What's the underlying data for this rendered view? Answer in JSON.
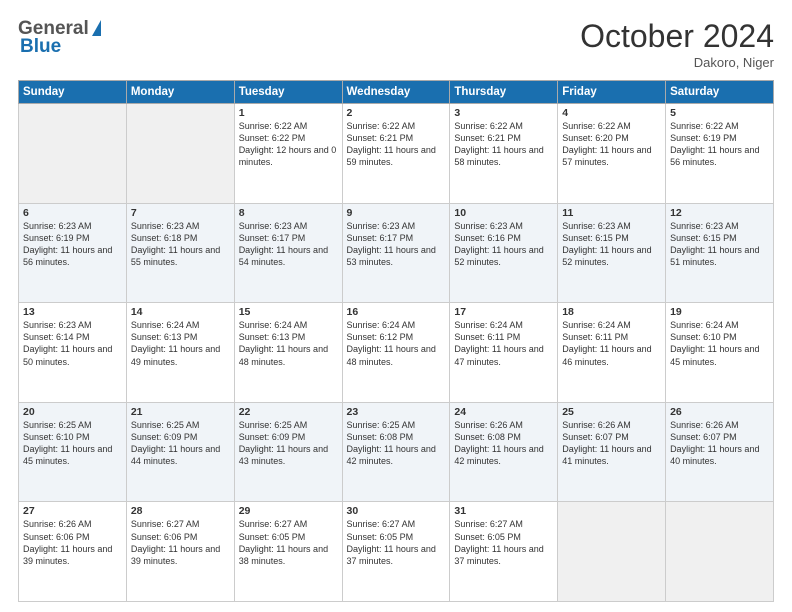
{
  "header": {
    "logo_general": "General",
    "logo_blue": "Blue",
    "month_title": "October 2024",
    "location": "Dakoro, Niger"
  },
  "days_of_week": [
    "Sunday",
    "Monday",
    "Tuesday",
    "Wednesday",
    "Thursday",
    "Friday",
    "Saturday"
  ],
  "weeks": [
    [
      {
        "day": "",
        "empty": true
      },
      {
        "day": "",
        "empty": true
      },
      {
        "day": "1",
        "sunrise": "6:22 AM",
        "sunset": "6:22 PM",
        "daylight": "12 hours and 0 minutes."
      },
      {
        "day": "2",
        "sunrise": "6:22 AM",
        "sunset": "6:21 PM",
        "daylight": "11 hours and 59 minutes."
      },
      {
        "day": "3",
        "sunrise": "6:22 AM",
        "sunset": "6:21 PM",
        "daylight": "11 hours and 58 minutes."
      },
      {
        "day": "4",
        "sunrise": "6:22 AM",
        "sunset": "6:20 PM",
        "daylight": "11 hours and 57 minutes."
      },
      {
        "day": "5",
        "sunrise": "6:22 AM",
        "sunset": "6:19 PM",
        "daylight": "11 hours and 56 minutes."
      }
    ],
    [
      {
        "day": "6",
        "sunrise": "6:23 AM",
        "sunset": "6:19 PM",
        "daylight": "11 hours and 56 minutes."
      },
      {
        "day": "7",
        "sunrise": "6:23 AM",
        "sunset": "6:18 PM",
        "daylight": "11 hours and 55 minutes."
      },
      {
        "day": "8",
        "sunrise": "6:23 AM",
        "sunset": "6:17 PM",
        "daylight": "11 hours and 54 minutes."
      },
      {
        "day": "9",
        "sunrise": "6:23 AM",
        "sunset": "6:17 PM",
        "daylight": "11 hours and 53 minutes."
      },
      {
        "day": "10",
        "sunrise": "6:23 AM",
        "sunset": "6:16 PM",
        "daylight": "11 hours and 52 minutes."
      },
      {
        "day": "11",
        "sunrise": "6:23 AM",
        "sunset": "6:15 PM",
        "daylight": "11 hours and 52 minutes."
      },
      {
        "day": "12",
        "sunrise": "6:23 AM",
        "sunset": "6:15 PM",
        "daylight": "11 hours and 51 minutes."
      }
    ],
    [
      {
        "day": "13",
        "sunrise": "6:23 AM",
        "sunset": "6:14 PM",
        "daylight": "11 hours and 50 minutes."
      },
      {
        "day": "14",
        "sunrise": "6:24 AM",
        "sunset": "6:13 PM",
        "daylight": "11 hours and 49 minutes."
      },
      {
        "day": "15",
        "sunrise": "6:24 AM",
        "sunset": "6:13 PM",
        "daylight": "11 hours and 48 minutes."
      },
      {
        "day": "16",
        "sunrise": "6:24 AM",
        "sunset": "6:12 PM",
        "daylight": "11 hours and 48 minutes."
      },
      {
        "day": "17",
        "sunrise": "6:24 AM",
        "sunset": "6:11 PM",
        "daylight": "11 hours and 47 minutes."
      },
      {
        "day": "18",
        "sunrise": "6:24 AM",
        "sunset": "6:11 PM",
        "daylight": "11 hours and 46 minutes."
      },
      {
        "day": "19",
        "sunrise": "6:24 AM",
        "sunset": "6:10 PM",
        "daylight": "11 hours and 45 minutes."
      }
    ],
    [
      {
        "day": "20",
        "sunrise": "6:25 AM",
        "sunset": "6:10 PM",
        "daylight": "11 hours and 45 minutes."
      },
      {
        "day": "21",
        "sunrise": "6:25 AM",
        "sunset": "6:09 PM",
        "daylight": "11 hours and 44 minutes."
      },
      {
        "day": "22",
        "sunrise": "6:25 AM",
        "sunset": "6:09 PM",
        "daylight": "11 hours and 43 minutes."
      },
      {
        "day": "23",
        "sunrise": "6:25 AM",
        "sunset": "6:08 PM",
        "daylight": "11 hours and 42 minutes."
      },
      {
        "day": "24",
        "sunrise": "6:26 AM",
        "sunset": "6:08 PM",
        "daylight": "11 hours and 42 minutes."
      },
      {
        "day": "25",
        "sunrise": "6:26 AM",
        "sunset": "6:07 PM",
        "daylight": "11 hours and 41 minutes."
      },
      {
        "day": "26",
        "sunrise": "6:26 AM",
        "sunset": "6:07 PM",
        "daylight": "11 hours and 40 minutes."
      }
    ],
    [
      {
        "day": "27",
        "sunrise": "6:26 AM",
        "sunset": "6:06 PM",
        "daylight": "11 hours and 39 minutes."
      },
      {
        "day": "28",
        "sunrise": "6:27 AM",
        "sunset": "6:06 PM",
        "daylight": "11 hours and 39 minutes."
      },
      {
        "day": "29",
        "sunrise": "6:27 AM",
        "sunset": "6:05 PM",
        "daylight": "11 hours and 38 minutes."
      },
      {
        "day": "30",
        "sunrise": "6:27 AM",
        "sunset": "6:05 PM",
        "daylight": "11 hours and 37 minutes."
      },
      {
        "day": "31",
        "sunrise": "6:27 AM",
        "sunset": "6:05 PM",
        "daylight": "11 hours and 37 minutes."
      },
      {
        "day": "",
        "empty": true
      },
      {
        "day": "",
        "empty": true
      }
    ]
  ],
  "labels": {
    "sunrise": "Sunrise:",
    "sunset": "Sunset:",
    "daylight": "Daylight:"
  }
}
